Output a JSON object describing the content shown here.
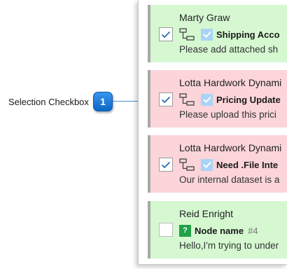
{
  "annotation": {
    "label": "Selection Checkbox",
    "badge_number": "1",
    "badge_color": "#1a7ad6"
  },
  "colors": {
    "card_green": "#d5f8d1",
    "card_red": "#fbd5d9",
    "card_border": "#a8a8a8",
    "check_color": "#2b6cb0",
    "type_icon_bg": "#a9d4f7",
    "question_icon_bg": "#21a047"
  },
  "cards": [
    {
      "status": "green",
      "checked": true,
      "name": "Marty Graw",
      "type_icon": "check-icon",
      "title": "Shipping Acco",
      "number": "",
      "body": "Please add attached sh"
    },
    {
      "status": "red",
      "checked": true,
      "name": "Lotta Hardwork Dynami",
      "type_icon": "check-icon",
      "title": "Pricing Update",
      "number": "",
      "body": "Please upload this prici"
    },
    {
      "status": "red",
      "checked": true,
      "name": "Lotta Hardwork Dynami",
      "type_icon": "check-icon",
      "title": "Need .File Inte",
      "number": "",
      "body": "Our internal dataset is a"
    },
    {
      "status": "green",
      "checked": false,
      "name": "Reid Enright",
      "type_icon": "question-icon",
      "type_icon_text": "?",
      "title": "Node name",
      "number": "#4",
      "body": "Hello,I'm trying to under"
    }
  ]
}
